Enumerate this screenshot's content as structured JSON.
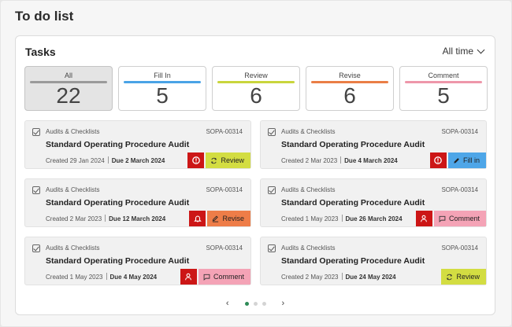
{
  "page_title": "To do list",
  "card_title": "Tasks",
  "period_label": "All time",
  "stats": [
    {
      "label": "All",
      "count": "22",
      "color": "#9a9a9a",
      "active": true
    },
    {
      "label": "Fill In",
      "count": "5",
      "color": "#4aa3e6",
      "active": false
    },
    {
      "label": "Review",
      "count": "6",
      "color": "#c9d53c",
      "active": false
    },
    {
      "label": "Revise",
      "count": "6",
      "color": "#ea7e46",
      "active": false
    },
    {
      "label": "Comment",
      "count": "5",
      "color": "#ee97aa",
      "active": false
    }
  ],
  "tasks": [
    {
      "category": "Audits & Checklists",
      "code": "SOPA-00314",
      "name": "Standard Operating Procedure Audit",
      "created": "Created 29 Jan 2024",
      "due": "Due 2 March 2024",
      "icon": "alert-icon",
      "status": "Review",
      "status_icon": "review-icon",
      "status_color": "#d3dd42"
    },
    {
      "category": "Audits & Checklists",
      "code": "SOPA-00314",
      "name": "Standard Operating Procedure Audit",
      "created": "Created 2 Mar 2023",
      "due": "Due 4 March 2024",
      "icon": "alert-icon",
      "status": "Fill in",
      "status_icon": "pencil-icon",
      "status_color": "#4ea6e8"
    },
    {
      "category": "Audits & Checklists",
      "code": "SOPA-00314",
      "name": "Standard Operating Procedure Audit",
      "created": "Created 2 Mar 2023",
      "due": "Due 12 March 2024",
      "icon": "bell-icon",
      "status": "Revise",
      "status_icon": "edit-icon",
      "status_color": "#ee7d48"
    },
    {
      "category": "Audits & Checklists",
      "code": "SOPA-00314",
      "name": "Standard Operating Procedure Audit",
      "created": "Created 1 May 2023",
      "due": "Due 26 March 2024",
      "icon": "user-icon",
      "status": "Comment",
      "status_icon": "comment-icon",
      "status_color": "#f4a3b6"
    },
    {
      "category": "Audits & Checklists",
      "code": "SOPA-00314",
      "name": "Standard Operating Procedure Audit",
      "created": "Created 1 May 2023",
      "due": "Due 4 May 2024",
      "icon": "user-icon",
      "status": "Comment",
      "status_icon": "comment-icon",
      "status_color": "#f4a3b6"
    },
    {
      "category": "Audits & Checklists",
      "code": "SOPA-00314",
      "name": "Standard Operating Procedure Audit",
      "created": "Created 2 May 2023",
      "due": "Due 24 May 2024",
      "icon": null,
      "status": "Review",
      "status_icon": "review-icon",
      "status_color": "#d3dd42"
    }
  ],
  "pagination": {
    "prev": "‹",
    "next": "›",
    "pages": 3,
    "current": 0
  }
}
